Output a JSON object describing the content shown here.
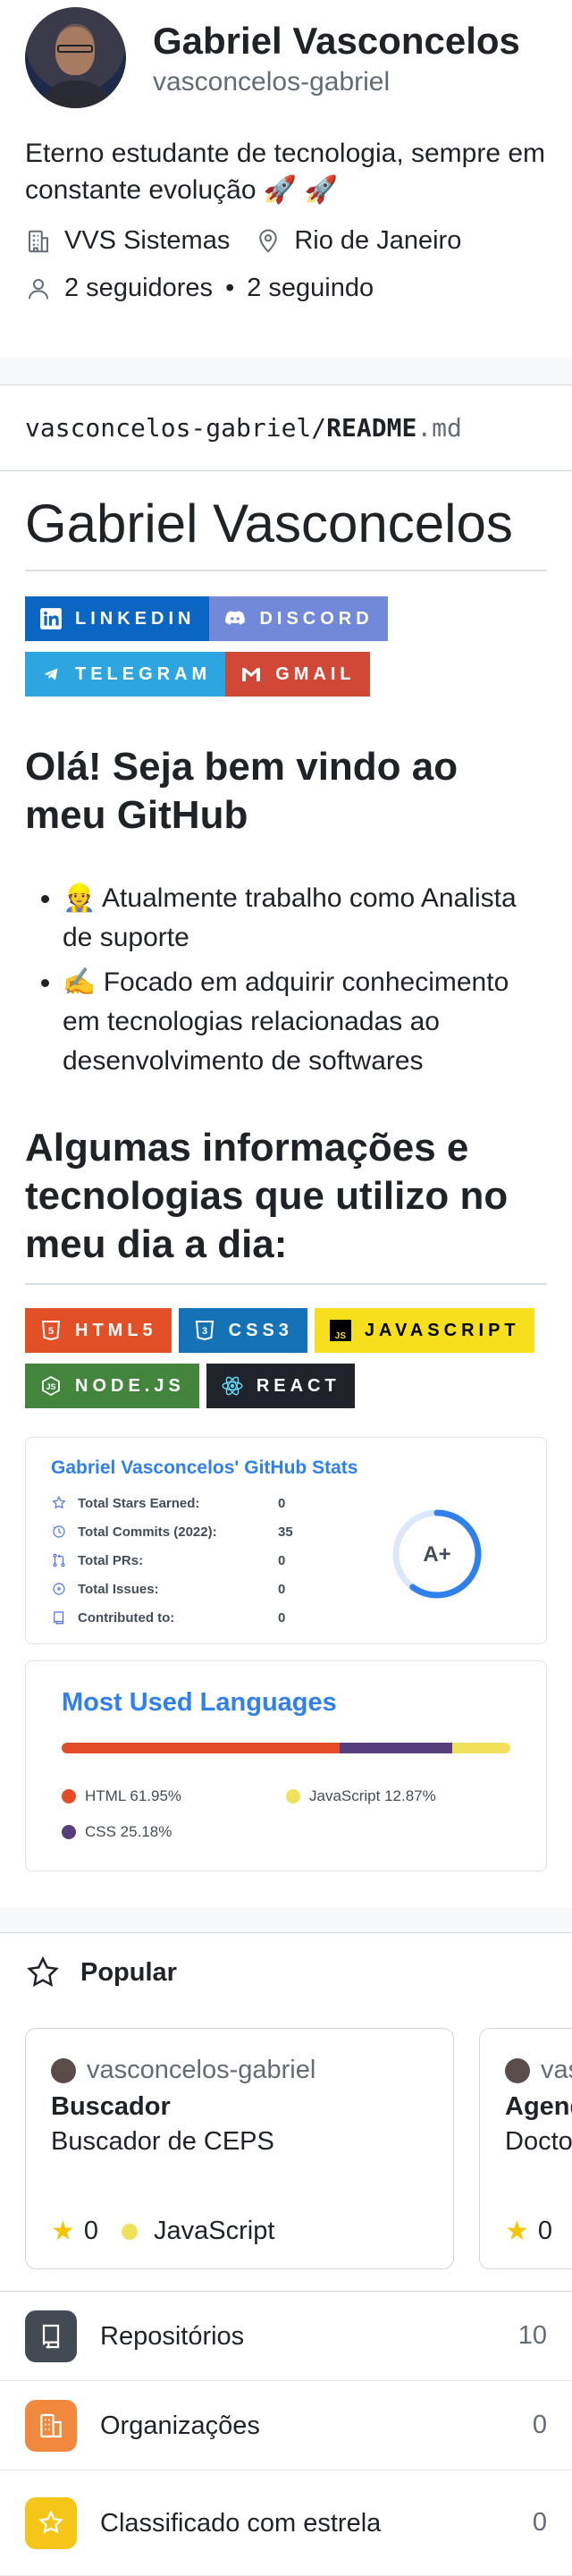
{
  "profile": {
    "name": "Gabriel Vasconcelos",
    "username": "vasconcelos-gabriel",
    "bio": "Eterno estudante de tecnologia, sempre em constante evolução 🚀 🚀",
    "company": "VVS Sistemas",
    "location": "Rio de Janeiro",
    "followers": "2 seguidores",
    "following": "2 seguindo",
    "separator": "•"
  },
  "readme": {
    "path_owner": "vasconcelos-gabriel/",
    "path_file": "README",
    "path_ext": ".md",
    "title": "Gabriel Vasconcelos",
    "social_badges": [
      {
        "label": "LINKEDIN",
        "color": "#0a66c2",
        "icon": "in"
      },
      {
        "label": "DISCORD",
        "color": "#7289da",
        "icon": "discord"
      },
      {
        "label": "TELEGRAM",
        "color": "#2ca5e0",
        "icon": "telegram"
      },
      {
        "label": "GMAIL",
        "color": "#d14836",
        "icon": "M"
      }
    ],
    "greeting": "Olá! Seja bem vindo ao meu GitHub",
    "bullets": [
      "👷 Atualmente trabalho como Analista de suporte",
      "✍️ Focado em adquirir conhecimento em tecnologias relacionadas ao desenvolvimento de softwares"
    ],
    "tech_heading": "Algumas informações e tecnologias que utilizo no meu dia a dia:",
    "tech_badges": [
      {
        "label": "HTML5",
        "color": "#e34f26",
        "text": "#ffffff",
        "icon": "5"
      },
      {
        "label": "CSS3",
        "color": "#1572b6",
        "text": "#ffffff",
        "icon": "3"
      },
      {
        "label": "JAVASCRIPT",
        "color": "#f7df1e",
        "text": "#000000",
        "icon": "JS"
      },
      {
        "label": "NODE.JS",
        "color": "#43853d",
        "text": "#ffffff",
        "icon": "⬡"
      },
      {
        "label": "REACT",
        "color": "#20232a",
        "text": "#ffffff",
        "icon": "⚛"
      }
    ],
    "stats": {
      "title": "Gabriel Vasconcelos' GitHub Stats",
      "rows": [
        {
          "label": "Total Stars Earned:",
          "value": "0",
          "icon": "star-icon"
        },
        {
          "label": "Total Commits (2022):",
          "value": "35",
          "icon": "clock-icon"
        },
        {
          "label": "Total PRs:",
          "value": "0",
          "icon": "pull-request-icon"
        },
        {
          "label": "Total Issues:",
          "value": "0",
          "icon": "issue-icon"
        },
        {
          "label": "Contributed to:",
          "value": "0",
          "icon": "repo-icon"
        }
      ],
      "grade": "A+",
      "grade_progress": 0.6,
      "accent": "#2f80ed"
    },
    "languages": {
      "title": "Most Used Languages",
      "items": [
        {
          "name": "HTML",
          "percent": 61.95,
          "label": "HTML 61.95%",
          "color": "#e34c26"
        },
        {
          "name": "CSS",
          "percent": 25.18,
          "label": "CSS 25.18%",
          "color": "#563d7c"
        },
        {
          "name": "JavaScript",
          "percent": 12.87,
          "label": "JavaScript 12.87%",
          "color": "#f1e05a"
        }
      ]
    }
  },
  "popular": {
    "heading": "Popular",
    "repos": [
      {
        "owner": "vasconcelos-gabriel",
        "name": "Buscador",
        "description": "Buscador de CEPS",
        "stars": "0",
        "language": "JavaScript"
      },
      {
        "owner": "vasconcelos-gabriel",
        "name": "Agendamento",
        "description": "Doctor",
        "stars": "0",
        "language": ""
      }
    ]
  },
  "menu": [
    {
      "label": "Repositórios",
      "count": "10",
      "color": "#424a53",
      "icon": "repo-icon"
    },
    {
      "label": "Organizações",
      "count": "0",
      "color": "#f0883e",
      "icon": "organization-icon"
    },
    {
      "label": "Classificado com estrela",
      "count": "0",
      "color": "#f5c518",
      "icon": "star-icon"
    }
  ]
}
